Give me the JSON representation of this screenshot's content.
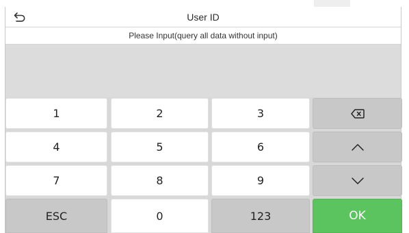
{
  "header": {
    "title": "User ID",
    "back_icon": "back-arrow-icon"
  },
  "prompt": {
    "text": "Please Input(query all data without input)"
  },
  "input": {
    "value": ""
  },
  "keypad": {
    "keys": [
      {
        "label": "1"
      },
      {
        "label": "2"
      },
      {
        "label": "3"
      },
      {
        "label": "",
        "icon": "backspace-icon"
      },
      {
        "label": "4"
      },
      {
        "label": "5"
      },
      {
        "label": "6"
      },
      {
        "label": "",
        "icon": "chevron-up-icon"
      },
      {
        "label": "7"
      },
      {
        "label": "8"
      },
      {
        "label": "9"
      },
      {
        "label": "",
        "icon": "chevron-down-icon"
      },
      {
        "label": "ESC"
      },
      {
        "label": "0"
      },
      {
        "label": "123"
      },
      {
        "label": "OK"
      }
    ]
  },
  "colors": {
    "ok_key": "#5cc45f",
    "function_key": "#c8c8c8",
    "digit_key": "#ffffff",
    "background": "#d8d8d8"
  }
}
